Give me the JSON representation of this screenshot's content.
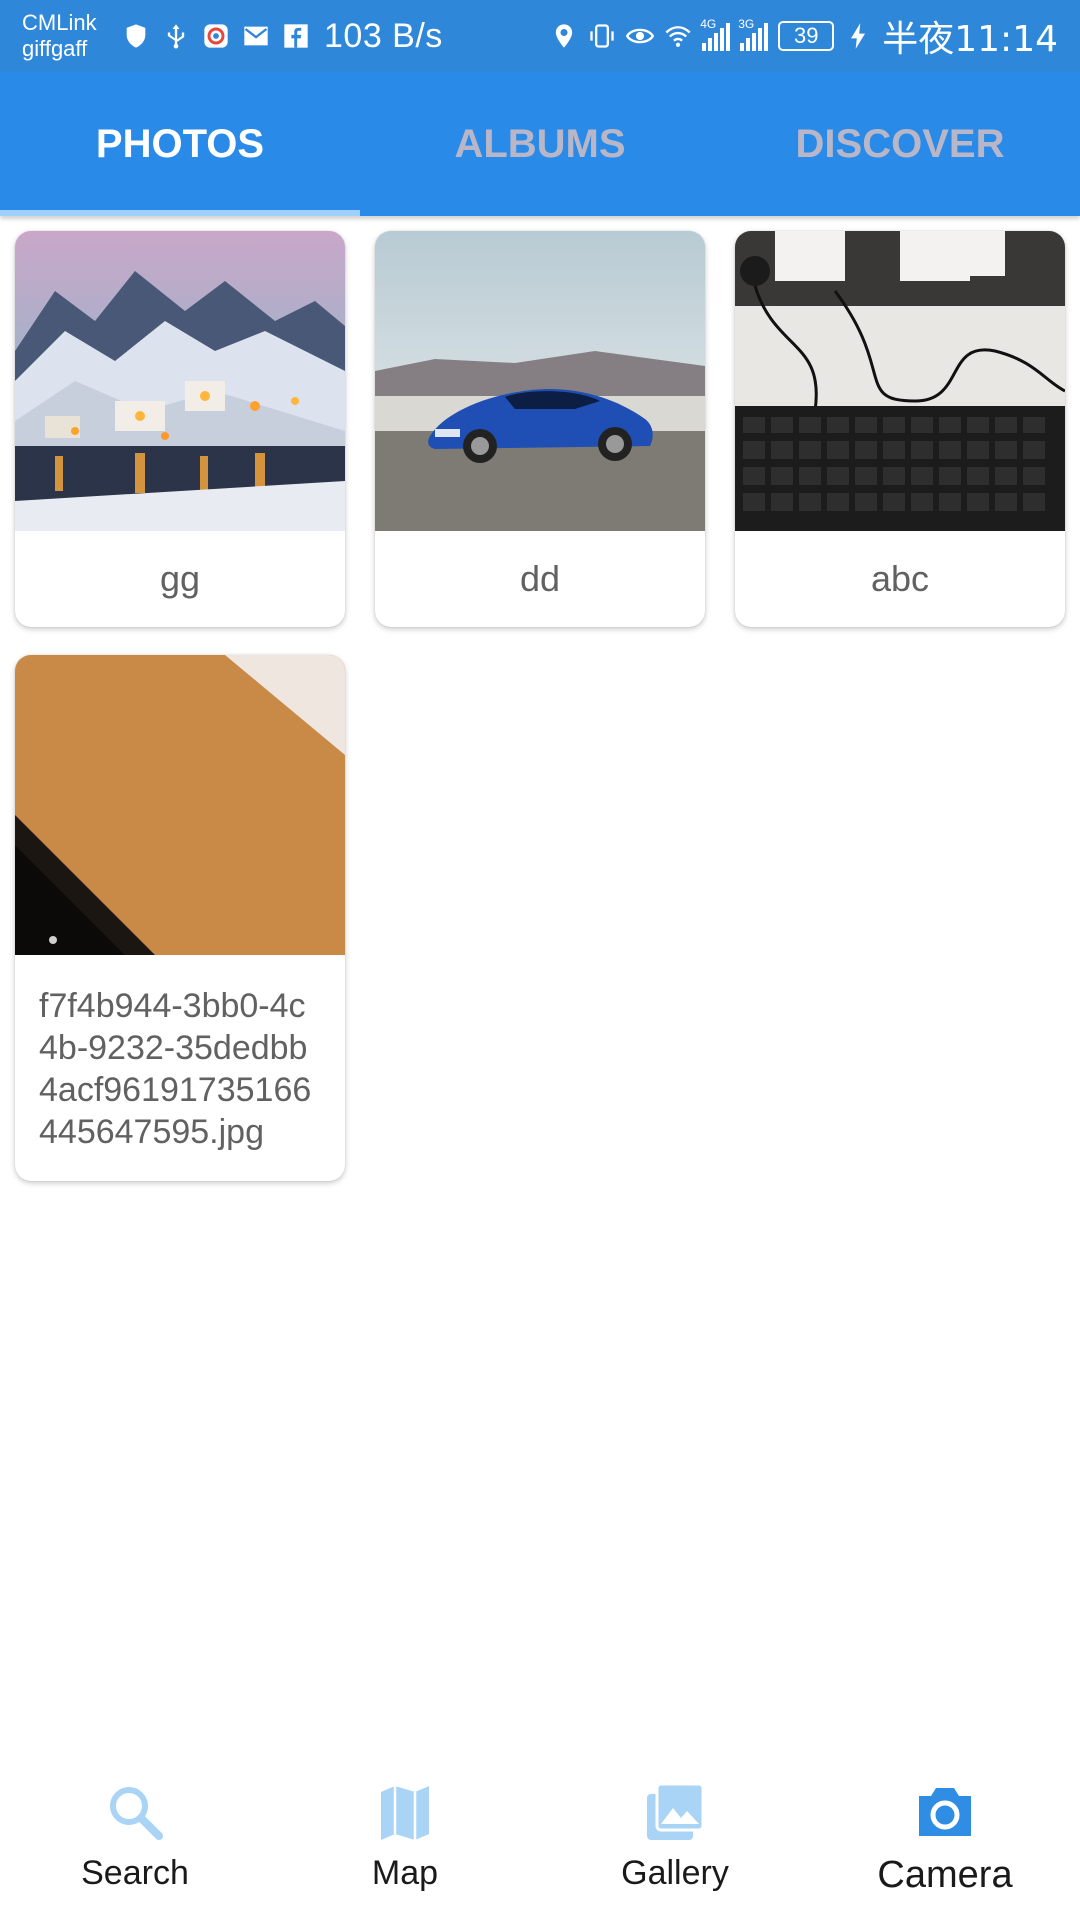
{
  "status_bar": {
    "carrier_1": "CMLink",
    "carrier_2": "giffgaff",
    "net_speed": "103 B/s",
    "signal_1_tag": "4G",
    "signal_2_tag": "3G",
    "battery": "39",
    "time": "半夜11:14",
    "icons": [
      "shield-icon",
      "usb-icon",
      "app-icon",
      "mail-icon",
      "facebook-icon",
      "location-icon",
      "vibrate-icon",
      "eye-icon",
      "wifi-icon",
      "signal-icon",
      "charging-icon"
    ]
  },
  "tabs": [
    {
      "label": "PHOTOS",
      "active": true
    },
    {
      "label": "ALBUMS",
      "active": false
    },
    {
      "label": "DISCOVER",
      "active": false
    }
  ],
  "photos": [
    {
      "caption": "gg",
      "thumbnail": "snowy-village"
    },
    {
      "caption": "dd",
      "thumbnail": "blue-car"
    },
    {
      "caption": "abc",
      "thumbnail": "keyboard"
    },
    {
      "caption": "f7f4b944-3bb0-4c4b-9232-35dedbb4acf96191735166445647595.jpg",
      "thumbnail": "orange-surface"
    }
  ],
  "bottom_nav": [
    {
      "label": "Search",
      "icon": "search-icon",
      "active": false
    },
    {
      "label": "Map",
      "icon": "map-icon",
      "active": false
    },
    {
      "label": "Gallery",
      "icon": "gallery-icon",
      "active": false
    },
    {
      "label": "Camera",
      "icon": "camera-icon",
      "active": true
    }
  ],
  "colors": {
    "status_bar": "#2f87d9",
    "tab_bar": "#2a8ae8",
    "tab_inactive": "#b9b7c7",
    "tab_indicator": "#9fd0ff",
    "nav_inactive_icon": "#a9d4f5",
    "nav_active_icon": "#2f8de4"
  }
}
